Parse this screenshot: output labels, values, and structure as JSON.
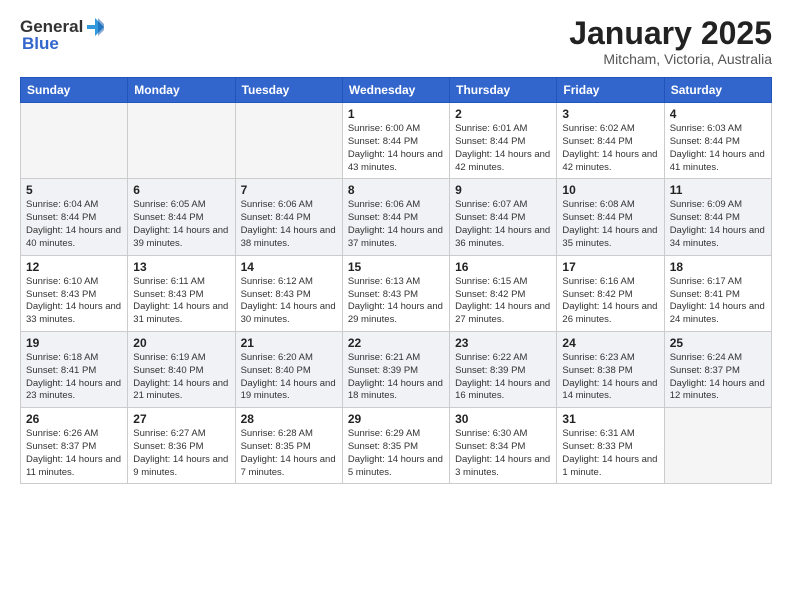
{
  "header": {
    "logo_general": "General",
    "logo_blue": "Blue",
    "title": "January 2025",
    "subtitle": "Mitcham, Victoria, Australia"
  },
  "days_of_week": [
    "Sunday",
    "Monday",
    "Tuesday",
    "Wednesday",
    "Thursday",
    "Friday",
    "Saturday"
  ],
  "weeks": [
    {
      "shaded": false,
      "days": [
        {
          "num": "",
          "empty": true
        },
        {
          "num": "",
          "empty": true
        },
        {
          "num": "",
          "empty": true
        },
        {
          "num": "1",
          "sunrise": "6:00 AM",
          "sunset": "8:44 PM",
          "daylight": "14 hours and 43 minutes."
        },
        {
          "num": "2",
          "sunrise": "6:01 AM",
          "sunset": "8:44 PM",
          "daylight": "14 hours and 42 minutes."
        },
        {
          "num": "3",
          "sunrise": "6:02 AM",
          "sunset": "8:44 PM",
          "daylight": "14 hours and 42 minutes."
        },
        {
          "num": "4",
          "sunrise": "6:03 AM",
          "sunset": "8:44 PM",
          "daylight": "14 hours and 41 minutes."
        }
      ]
    },
    {
      "shaded": true,
      "days": [
        {
          "num": "5",
          "sunrise": "6:04 AM",
          "sunset": "8:44 PM",
          "daylight": "14 hours and 40 minutes."
        },
        {
          "num": "6",
          "sunrise": "6:05 AM",
          "sunset": "8:44 PM",
          "daylight": "14 hours and 39 minutes."
        },
        {
          "num": "7",
          "sunrise": "6:06 AM",
          "sunset": "8:44 PM",
          "daylight": "14 hours and 38 minutes."
        },
        {
          "num": "8",
          "sunrise": "6:06 AM",
          "sunset": "8:44 PM",
          "daylight": "14 hours and 37 minutes."
        },
        {
          "num": "9",
          "sunrise": "6:07 AM",
          "sunset": "8:44 PM",
          "daylight": "14 hours and 36 minutes."
        },
        {
          "num": "10",
          "sunrise": "6:08 AM",
          "sunset": "8:44 PM",
          "daylight": "14 hours and 35 minutes."
        },
        {
          "num": "11",
          "sunrise": "6:09 AM",
          "sunset": "8:44 PM",
          "daylight": "14 hours and 34 minutes."
        }
      ]
    },
    {
      "shaded": false,
      "days": [
        {
          "num": "12",
          "sunrise": "6:10 AM",
          "sunset": "8:43 PM",
          "daylight": "14 hours and 33 minutes."
        },
        {
          "num": "13",
          "sunrise": "6:11 AM",
          "sunset": "8:43 PM",
          "daylight": "14 hours and 31 minutes."
        },
        {
          "num": "14",
          "sunrise": "6:12 AM",
          "sunset": "8:43 PM",
          "daylight": "14 hours and 30 minutes."
        },
        {
          "num": "15",
          "sunrise": "6:13 AM",
          "sunset": "8:43 PM",
          "daylight": "14 hours and 29 minutes."
        },
        {
          "num": "16",
          "sunrise": "6:15 AM",
          "sunset": "8:42 PM",
          "daylight": "14 hours and 27 minutes."
        },
        {
          "num": "17",
          "sunrise": "6:16 AM",
          "sunset": "8:42 PM",
          "daylight": "14 hours and 26 minutes."
        },
        {
          "num": "18",
          "sunrise": "6:17 AM",
          "sunset": "8:41 PM",
          "daylight": "14 hours and 24 minutes."
        }
      ]
    },
    {
      "shaded": true,
      "days": [
        {
          "num": "19",
          "sunrise": "6:18 AM",
          "sunset": "8:41 PM",
          "daylight": "14 hours and 23 minutes."
        },
        {
          "num": "20",
          "sunrise": "6:19 AM",
          "sunset": "8:40 PM",
          "daylight": "14 hours and 21 minutes."
        },
        {
          "num": "21",
          "sunrise": "6:20 AM",
          "sunset": "8:40 PM",
          "daylight": "14 hours and 19 minutes."
        },
        {
          "num": "22",
          "sunrise": "6:21 AM",
          "sunset": "8:39 PM",
          "daylight": "14 hours and 18 minutes."
        },
        {
          "num": "23",
          "sunrise": "6:22 AM",
          "sunset": "8:39 PM",
          "daylight": "14 hours and 16 minutes."
        },
        {
          "num": "24",
          "sunrise": "6:23 AM",
          "sunset": "8:38 PM",
          "daylight": "14 hours and 14 minutes."
        },
        {
          "num": "25",
          "sunrise": "6:24 AM",
          "sunset": "8:37 PM",
          "daylight": "14 hours and 12 minutes."
        }
      ]
    },
    {
      "shaded": false,
      "days": [
        {
          "num": "26",
          "sunrise": "6:26 AM",
          "sunset": "8:37 PM",
          "daylight": "14 hours and 11 minutes."
        },
        {
          "num": "27",
          "sunrise": "6:27 AM",
          "sunset": "8:36 PM",
          "daylight": "14 hours and 9 minutes."
        },
        {
          "num": "28",
          "sunrise": "6:28 AM",
          "sunset": "8:35 PM",
          "daylight": "14 hours and 7 minutes."
        },
        {
          "num": "29",
          "sunrise": "6:29 AM",
          "sunset": "8:35 PM",
          "daylight": "14 hours and 5 minutes."
        },
        {
          "num": "30",
          "sunrise": "6:30 AM",
          "sunset": "8:34 PM",
          "daylight": "14 hours and 3 minutes."
        },
        {
          "num": "31",
          "sunrise": "6:31 AM",
          "sunset": "8:33 PM",
          "daylight": "14 hours and 1 minute."
        },
        {
          "num": "",
          "empty": true
        }
      ]
    }
  ]
}
